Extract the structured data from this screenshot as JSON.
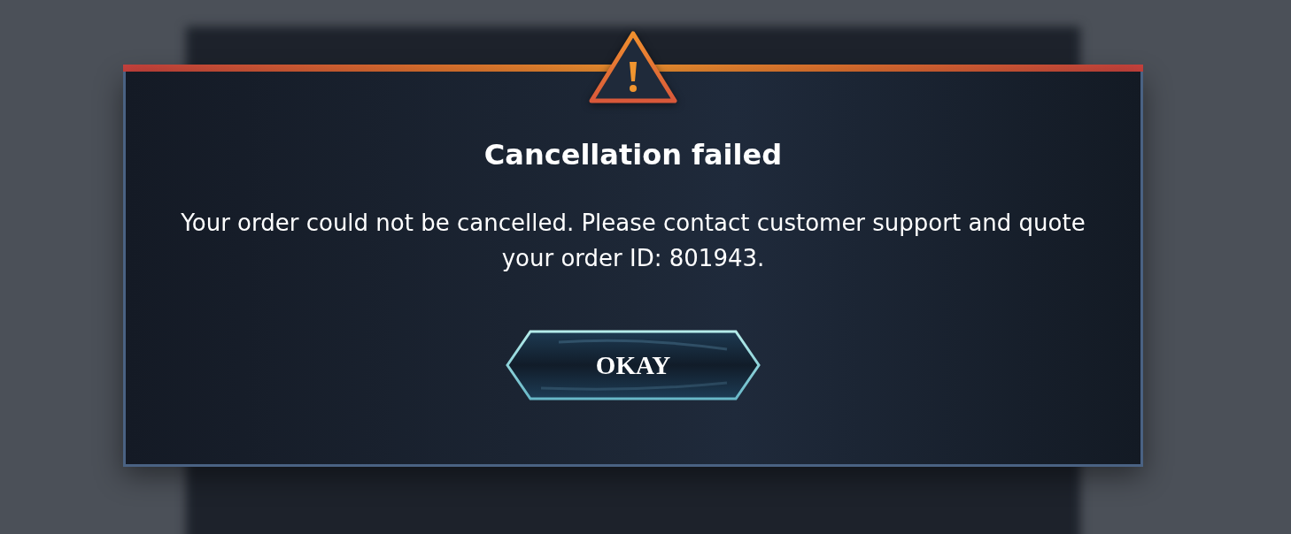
{
  "dialog": {
    "title": "Cancellation failed",
    "message": "Your order could not be cancelled. Please contact customer support and quote your order ID: 801943.",
    "button": {
      "label": "OKAY"
    }
  }
}
